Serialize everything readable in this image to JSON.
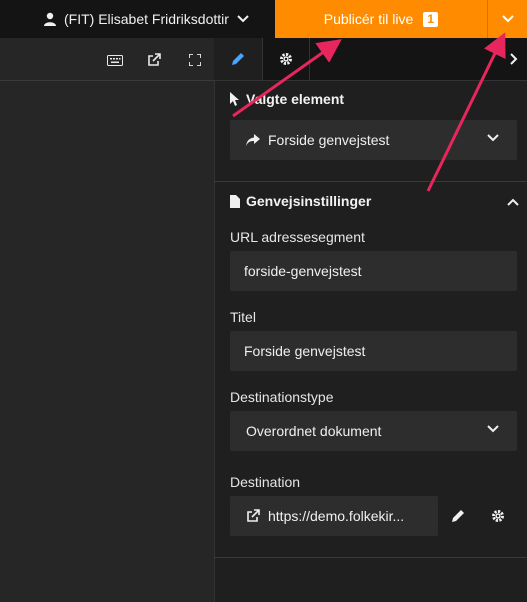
{
  "topbar": {
    "user_label": "(FIT) Elisabet Fridriksdottir",
    "publish_label": "Publicér til live",
    "publish_count": "1",
    "accent": "#ff8c00"
  },
  "left_toolbar": {
    "icons": [
      "keyboard-icon",
      "open-external-icon",
      "fullscreen-icon"
    ]
  },
  "tabs": {
    "items": [
      "edit-tab",
      "settings-tab"
    ]
  },
  "selected": {
    "title": "Valgte element",
    "value": "Forside genvejstest"
  },
  "shortcut": {
    "title": "Genvejsinstillinger",
    "url_label": "URL adressesegment",
    "url_value": "forside-genvejstest",
    "title_label": "Titel",
    "title_value": "Forside genvejstest",
    "desttype_label": "Destinationstype",
    "desttype_value": "Overordnet dokument",
    "dest_label": "Destination",
    "dest_value": "https://demo.folkekir..."
  },
  "annotation_color": "#e8265e"
}
